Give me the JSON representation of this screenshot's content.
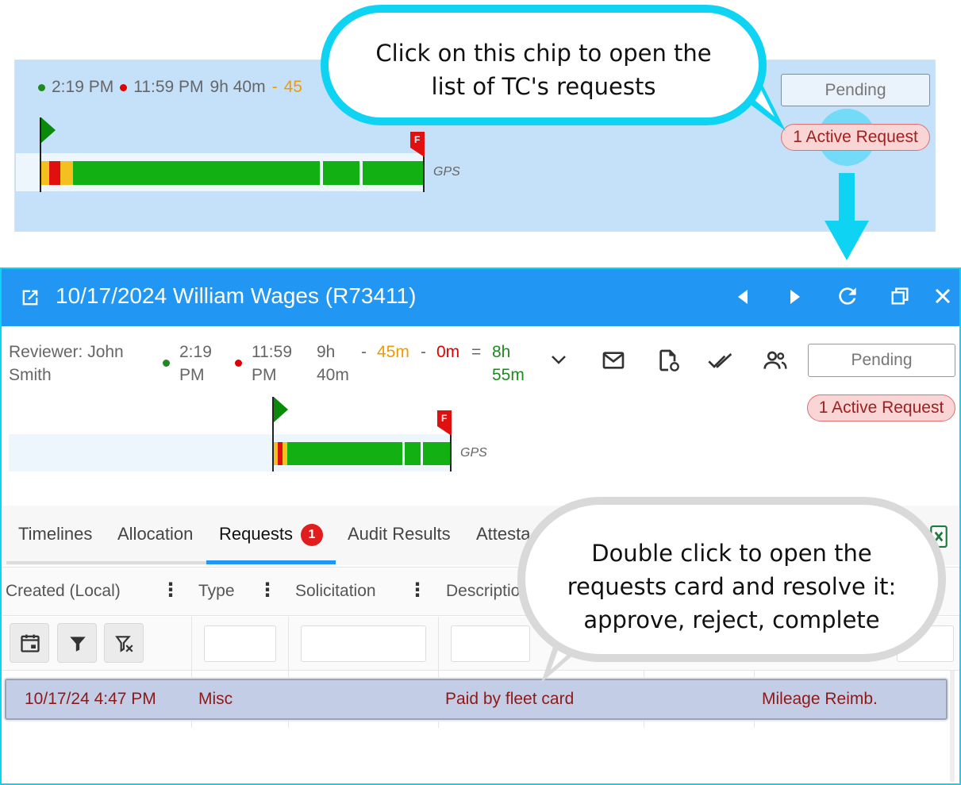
{
  "top_snippet": {
    "start_time": "2:19 PM",
    "end_time": "11:59 PM",
    "duration": "9h 40m",
    "dash": "-",
    "partial_value": "45",
    "pending_label": "Pending",
    "active_request_chip": "1 Active Request",
    "gps_label": "GPS",
    "flag_end_letter": "F"
  },
  "callouts": {
    "top_line1": "Click on this chip to open the",
    "top_line2": "list of TC's requests",
    "bottom_line1": "Double click to open the",
    "bottom_line2": "requests card and resolve it:",
    "bottom_line3": "approve, reject, complete"
  },
  "window": {
    "title": "10/17/2024 William Wages (R73411)",
    "icons": [
      "open-external-icon",
      "prev-icon",
      "next-icon",
      "refresh-icon",
      "restore-icon",
      "close-icon"
    ]
  },
  "summary": {
    "reviewer_line1": "Reviewer: John",
    "reviewer_line2": "Smith",
    "start_line1": "2:19",
    "start_line2": "PM",
    "end_line1": "11:59",
    "end_line2": "PM",
    "dur_line1": "9h",
    "dur_line2": "40m",
    "minus1": "-",
    "break_value": "45m",
    "minus2": "-",
    "deduct_value": "0m",
    "equals": "=",
    "total_line1": "8h",
    "total_line2": "55m",
    "pending_label": "Pending",
    "active_request_chip": "1 Active Request",
    "gps_label": "GPS",
    "flag_end_letter": "F"
  },
  "tabs": {
    "items": [
      {
        "label": "Timelines"
      },
      {
        "label": "Allocation"
      },
      {
        "label": "Requests",
        "badge": "1"
      },
      {
        "label": "Audit Results"
      },
      {
        "label": "Attesta"
      }
    ],
    "active": "Requests"
  },
  "grid": {
    "columns": [
      "Created (Local)",
      "Type",
      "Solicitation",
      "Descriptio"
    ],
    "rows": [
      {
        "created": "10/17/24 4:47 PM",
        "type": "Misc",
        "solicitation": "",
        "description": "Paid by fleet card",
        "col5": "",
        "col6": "Mileage Reimb."
      }
    ]
  },
  "colors": {
    "accent": "#2196f3",
    "callout_top_border": "#0fd3f3",
    "callout_bottom_border": "#d9d9d9",
    "bar_green": "#12b012",
    "bar_red": "#e01010",
    "bar_yellow": "#f4c020",
    "row_selected": "#c3cde6",
    "row_text": "#8b1a1a",
    "break_orange": "#f09a00",
    "deduct_red": "#e00000",
    "total_green": "#1e8a1e"
  }
}
